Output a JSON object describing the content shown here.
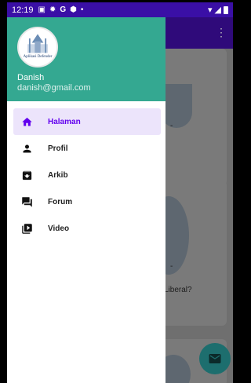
{
  "status_bar": {
    "time": "12:19",
    "icons": [
      "image-icon",
      "gear-icon",
      "g-icon",
      "shield-icon",
      "dot-icon"
    ],
    "right_icons": [
      "wifi-icon",
      "signal-icon",
      "battery-icon"
    ]
  },
  "drawer": {
    "avatar_logo_text": "Aplikasi Defender",
    "user_name": "Danish",
    "user_email": "danish@gmail.com",
    "items": [
      {
        "label": "Halaman",
        "icon": "home-icon",
        "active": true
      },
      {
        "label": "Profil",
        "icon": "person-icon",
        "active": false
      },
      {
        "label": "Arkib",
        "icon": "archive-icon",
        "active": false
      },
      {
        "label": "Forum",
        "icon": "forum-icon",
        "active": false
      },
      {
        "label": "Video",
        "icon": "video-library-icon",
        "active": false
      }
    ]
  },
  "background": {
    "card_dash_1": "-",
    "card_dash_2": "-",
    "card_snippet": "Liberal?",
    "fab_icon": "email-icon"
  },
  "colors": {
    "status_bar": "#3a0fa6",
    "app_bar": "#2f0a7a",
    "drawer_header": "#34a891",
    "active_item_bg": "#ece4fb",
    "active_item_text": "#6200ee",
    "fab": "#1d6e6e"
  }
}
